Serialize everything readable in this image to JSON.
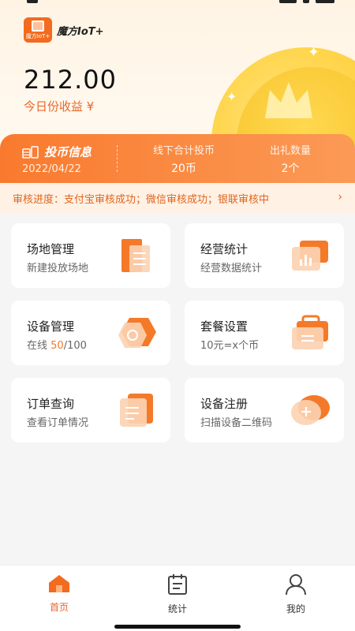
{
  "app": {
    "logo_text": "魔方IoT+",
    "logo_badge": "魔方IoT+"
  },
  "earnings": {
    "amount": "212.00",
    "label": "今日份收益 ¥"
  },
  "coin_info": {
    "title": "投币信息",
    "date": "2022/04/22",
    "offline_label": "线下合计投币",
    "offline_value": "20币",
    "gift_label": "出礼数量",
    "gift_value": "2个"
  },
  "notice": {
    "text": "审核进度：支付宝审核成功；微信审核成功；银联审核中",
    "arrow": "›"
  },
  "cards": [
    {
      "title": "场地管理",
      "sub": "新建投放场地",
      "icon": "building-icon"
    },
    {
      "title": "经营统计",
      "sub": "经营数据统计",
      "icon": "bar-chart-icon"
    },
    {
      "title": "设备管理",
      "sub_prefix": "在线 ",
      "sub_highlight": "50",
      "sub_suffix": "/100",
      "icon": "hexagon-device-icon"
    },
    {
      "title": "套餐设置",
      "sub": "10元=x个币",
      "icon": "briefcase-icon"
    },
    {
      "title": "订单查询",
      "sub": "查看订单情况",
      "icon": "clipboard-icon"
    },
    {
      "title": "设备注册",
      "sub": "扫描设备二维码",
      "icon": "add-circle-icon"
    }
  ],
  "tabs": [
    {
      "label": "首页",
      "icon": "home-icon",
      "active": true
    },
    {
      "label": "统计",
      "icon": "calendar-icon",
      "active": false
    },
    {
      "label": "我的",
      "icon": "user-icon",
      "active": false
    }
  ],
  "colors": {
    "accent": "#f26b1f",
    "accent_light": "#fb9a56",
    "notice_bg": "#fff1e4",
    "coin": "#ffd345"
  }
}
